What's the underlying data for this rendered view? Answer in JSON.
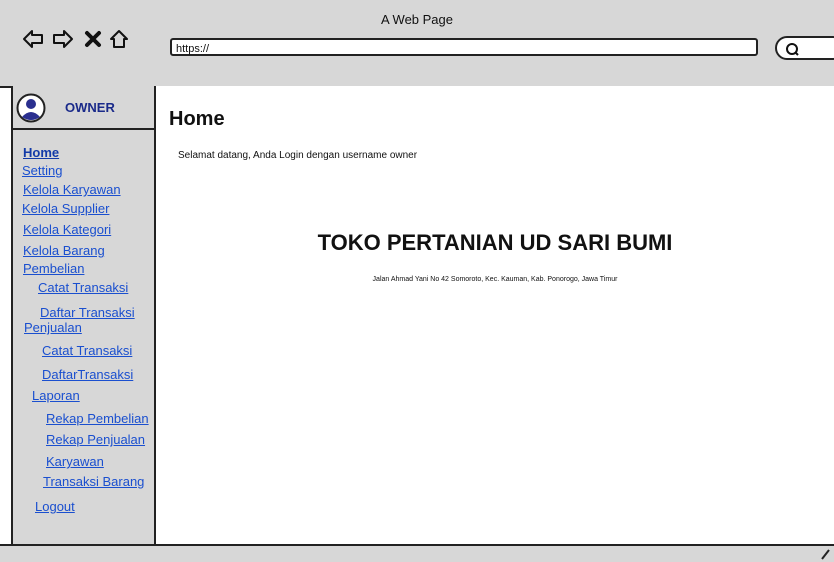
{
  "window": {
    "title": "A Web Page"
  },
  "browser": {
    "url": "https://"
  },
  "sidebar": {
    "user_label": "OWNER",
    "items": [
      {
        "label": "Home"
      },
      {
        "label": "Setting"
      },
      {
        "label": "Kelola Karyawan"
      },
      {
        "label": "Kelola Supplier"
      },
      {
        "label": "Kelola Kategori"
      },
      {
        "label": "Kelola Barang"
      },
      {
        "label": "Pembelian"
      },
      {
        "label": "Catat Transaksi"
      },
      {
        "label": "Daftar Transaksi"
      },
      {
        "label": "Penjualan"
      },
      {
        "label": "Catat Transaksi"
      },
      {
        "label": "DaftarTransaksi"
      },
      {
        "label": "Laporan"
      },
      {
        "label": "Rekap Pembelian"
      },
      {
        "label": "Rekap Penjualan"
      },
      {
        "label": "Karyawan"
      },
      {
        "label": "Transaksi Barang"
      },
      {
        "label": "Logout"
      }
    ]
  },
  "main": {
    "title": "Home",
    "welcome": "Selamat datang, Anda Login dengan username owner",
    "store_name": "TOKO PERTANIAN UD SARI BUMI",
    "store_address": "Jalan Ahmad Yani No 42 Somoroto, Kec. Kauman, Kab. Ponorogo, Jawa Timur"
  }
}
